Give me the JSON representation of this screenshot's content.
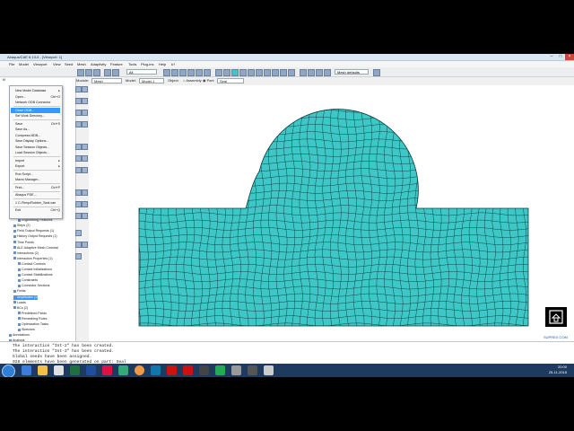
{
  "window": {
    "title": "Abaqus/CAE 6.13-5 - [Viewport: 1]"
  },
  "menubar": [
    "File",
    "Model",
    "Viewport",
    "View",
    "Seed",
    "Mesh",
    "Adaptivity",
    "Feature",
    "Tools",
    "Plug-ins",
    "Help",
    "k?"
  ],
  "context": {
    "module_label": "Module:",
    "module": "Mesh",
    "model_label": "Model:",
    "model": "Model-1",
    "object_label": "Object:",
    "assembly": "Assembly",
    "part_label": "Part:",
    "part": "Seal",
    "display": "Mesh defaults",
    "all": "All"
  },
  "file_menu": {
    "items": [
      {
        "label": "New Model Database",
        "shortcut": "▸"
      },
      {
        "label": "Open...",
        "shortcut": "Ctrl+O"
      },
      {
        "label": "Network ODB Connector",
        "shortcut": ""
      },
      {
        "label": "Close ODB...",
        "shortcut": "",
        "highlighted": true
      },
      {
        "label": "Set Work Directory...",
        "shortcut": ""
      },
      {
        "label": "Save",
        "shortcut": "Ctrl+S"
      },
      {
        "label": "Save As...",
        "shortcut": ""
      },
      {
        "label": "Compress MDB...",
        "shortcut": ""
      },
      {
        "label": "Save Display Options...",
        "shortcut": ""
      },
      {
        "label": "Save Session Objects...",
        "shortcut": ""
      },
      {
        "label": "Load Session Objects...",
        "shortcut": ""
      },
      {
        "label": "Import",
        "shortcut": "▸"
      },
      {
        "label": "Export",
        "shortcut": "▸"
      },
      {
        "label": "Run Script...",
        "shortcut": ""
      },
      {
        "label": "Macro Manager...",
        "shortcut": ""
      },
      {
        "label": "Print...",
        "shortcut": "Ctrl+P"
      },
      {
        "label": "Abaqus PDE...",
        "shortcut": ""
      },
      {
        "label": "1 C:/Temp/Rubber_Seal.cae",
        "shortcut": ""
      },
      {
        "label": "Exit",
        "shortcut": "Ctrl+Q"
      }
    ]
  },
  "tree": [
    {
      "label": "Connector Assignments",
      "indent": 2
    },
    {
      "label": "Engineering Features",
      "indent": 2
    },
    {
      "label": "Steps (2)",
      "indent": 1
    },
    {
      "label": "Field Output Requests (1)",
      "indent": 1
    },
    {
      "label": "History Output Requests (1)",
      "indent": 1
    },
    {
      "label": "Time Points",
      "indent": 1
    },
    {
      "label": "ALE Adaptive Mesh Constrai",
      "indent": 1
    },
    {
      "label": "Interactions (2)",
      "indent": 1
    },
    {
      "label": "Interaction Properties (1)",
      "indent": 1
    },
    {
      "label": "Contact Controls",
      "indent": 2
    },
    {
      "label": "Contact Initializations",
      "indent": 2
    },
    {
      "label": "Contact Stabilizations",
      "indent": 2
    },
    {
      "label": "Constraints",
      "indent": 2
    },
    {
      "label": "Connector Sections",
      "indent": 2
    },
    {
      "label": "Fields",
      "indent": 1
    },
    {
      "label": "Amplitudes (1)",
      "indent": 1,
      "highlighted": true
    },
    {
      "label": "Loads",
      "indent": 1
    },
    {
      "label": "BCs (2)",
      "indent": 1
    },
    {
      "label": "Predefined Fields",
      "indent": 2
    },
    {
      "label": "Remeshing Rules",
      "indent": 2
    },
    {
      "label": "Optimization Tasks",
      "indent": 2
    },
    {
      "label": "Sketches",
      "indent": 2
    },
    {
      "label": "Annotations",
      "indent": 0
    },
    {
      "label": "Analysis",
      "indent": 0
    },
    {
      "label": "Jobs",
      "indent": 1
    },
    {
      "label": "Adaptivity Processes",
      "indent": 1
    }
  ],
  "messages": [
    "The interaction \"Int-2\" has been created.",
    "The interaction \"Int-3\" has been created.",
    "Global seeds have been assigned.",
    "928 elements have been generated on part: Seal"
  ],
  "taskbar": {
    "time": "20:00",
    "date": "25-11-2018"
  },
  "colors": {
    "mesh_fill": "#3ec7c7",
    "mesh_line": "#0b3a3a",
    "highlight": "#3399ff"
  },
  "watermark": "SUPREX.COM"
}
